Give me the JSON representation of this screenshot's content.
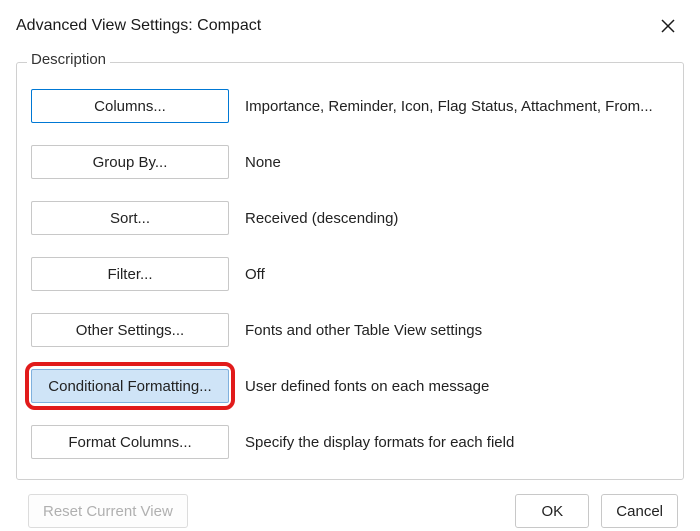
{
  "dialog": {
    "title": "Advanced View Settings: Compact"
  },
  "group": {
    "label": "Description"
  },
  "options": {
    "columns": {
      "label": "Columns...",
      "desc": "Importance, Reminder, Icon, Flag Status, Attachment, From..."
    },
    "group_by": {
      "label": "Group By...",
      "desc": "None"
    },
    "sort": {
      "label": "Sort...",
      "desc": "Received (descending)"
    },
    "filter": {
      "label": "Filter...",
      "desc": "Off"
    },
    "other": {
      "label": "Other Settings...",
      "desc": "Fonts and other Table View settings"
    },
    "cond_fmt": {
      "label": "Conditional Formatting...",
      "desc": "User defined fonts on each message"
    },
    "fmt_cols": {
      "label": "Format Columns...",
      "desc": "Specify the display formats for each field"
    }
  },
  "footer": {
    "reset": "Reset Current View",
    "ok": "OK",
    "cancel": "Cancel"
  }
}
